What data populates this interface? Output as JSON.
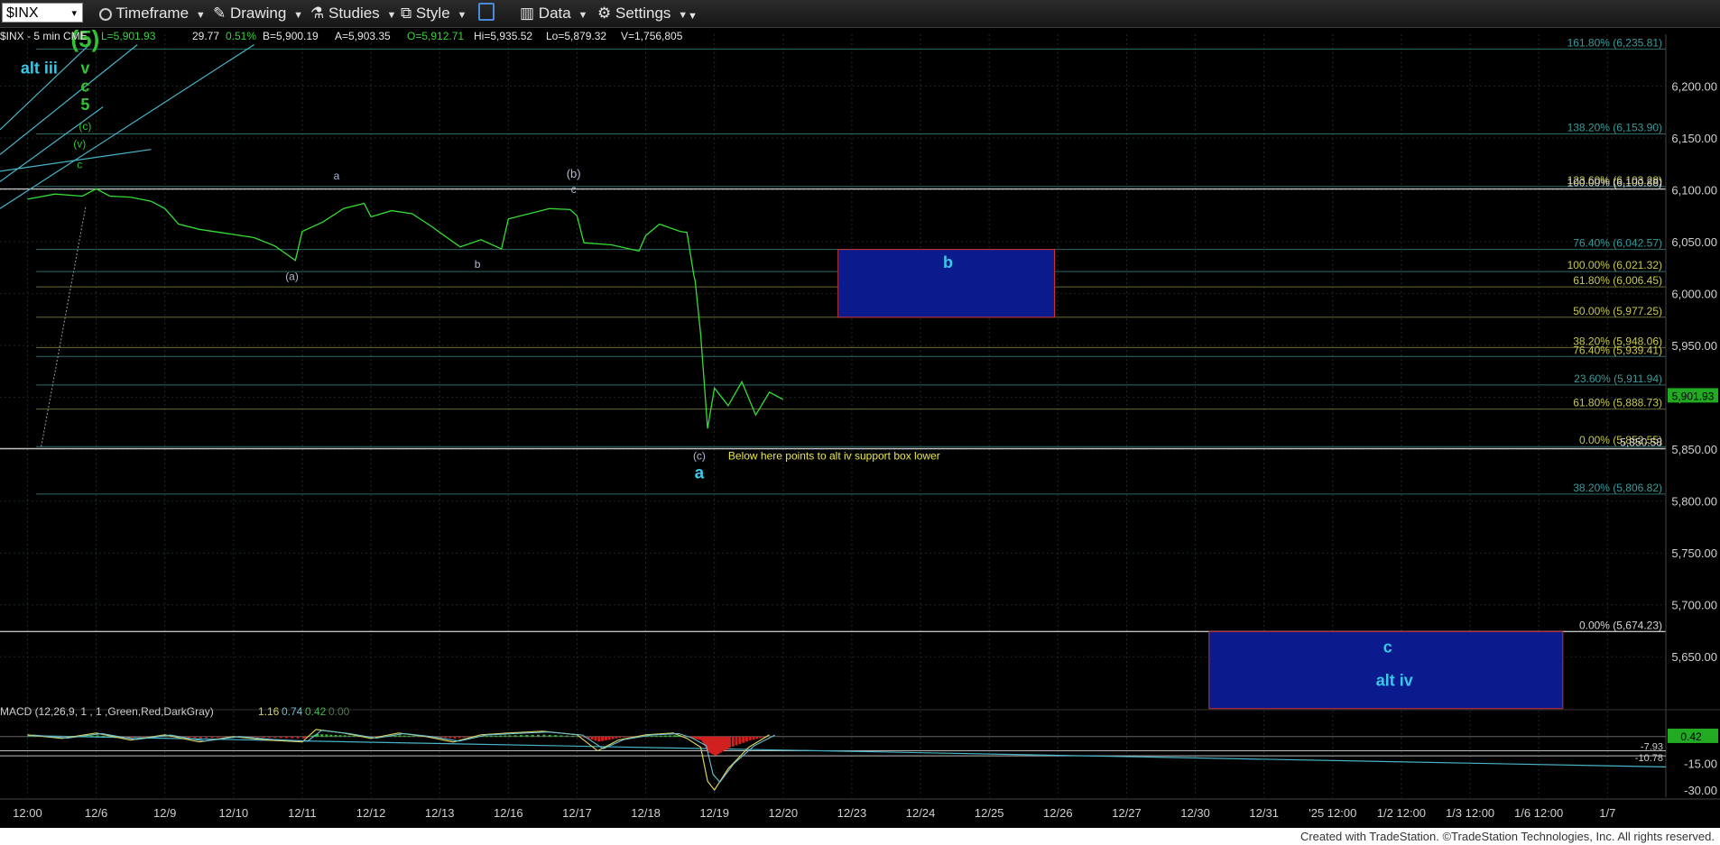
{
  "toolbar": {
    "symbol": "$INX",
    "timeframe": "Timeframe",
    "drawing": "Drawing",
    "studies": "Studies",
    "style": "Style",
    "data": "Data",
    "settings": "Settings"
  },
  "header": {
    "symbol_line": "$INX - 5 min  CME",
    "last": "L=5,901.93",
    "change": "29.77",
    "pct": "0.51%",
    "bid": "B=5,900.19",
    "ask": "A=5,903.35",
    "open": "O=5,912.71",
    "high": "Hi=5,935.52",
    "low": "Lo=5,879.32",
    "volume": "V=1,756,805"
  },
  "colors": {
    "price": "#33dd33",
    "fib_label": "#c8c850",
    "fib_teal": "#3a9a9a",
    "wave_label": "#b0b8d8",
    "box_blue": "#0b1a8c",
    "box_border": "#d03030",
    "alt_label": "#39c8e8",
    "wave5_green": "#31c431"
  },
  "chart_data": [
    {
      "type": "line",
      "title": "$INX - 5 min",
      "y_axis": {
        "ticks": [
          "6,200.00",
          "6,150.00",
          "6,100.00",
          "6,050.00",
          "6,000.00",
          "5,950.00",
          "5,900.00",
          "5,850.00",
          "5,800.00",
          "5,750.00",
          "5,700.00",
          "5,650.00"
        ],
        "tick_values": [
          6200,
          6150,
          6100,
          6050,
          6000,
          5950,
          5900,
          5850,
          5800,
          5750,
          5700,
          5650
        ],
        "range": [
          5605,
          6250
        ]
      },
      "x_axis": {
        "ticks": [
          "12:00",
          "12/6",
          "12/9",
          "12/10",
          "12/11",
          "12/12",
          "12/13",
          "12/16",
          "12/17",
          "12/18",
          "12/19",
          "12/20",
          "12/23",
          "12/24",
          "12/25",
          "12/26",
          "12/27",
          "12/30",
          "12/31",
          "'25 12:00",
          "1/2 12:00",
          "1/3 12:00",
          "1/6 12:00",
          "1/7"
        ],
        "tick_index": [
          0,
          1,
          2,
          3,
          4,
          5,
          6,
          7,
          8,
          9,
          10,
          11,
          12,
          13,
          14,
          15,
          16,
          17,
          18,
          19,
          20,
          21,
          22,
          23
        ],
        "range": [
          -0.4,
          23.85
        ]
      },
      "series": [
        {
          "x": [
            0,
            0.4,
            0.8,
            1.0,
            1.2,
            1.5,
            1.8,
            2.0,
            2.2,
            2.5,
            2.8,
            3.0,
            3.3,
            3.6,
            3.9,
            4.0,
            4.3,
            4.6,
            4.9,
            5.0,
            5.3,
            5.6,
            5.9,
            6.0,
            6.3,
            6.6,
            6.9,
            7.0,
            7.3,
            7.6,
            7.9,
            8.0,
            8.1,
            8.5,
            8.9,
            9.0,
            9.2,
            9.5,
            9.6,
            9.7,
            9.72,
            9.8,
            9.9,
            10.0,
            10.2,
            10.4,
            10.6,
            10.8,
            11.0
          ],
          "y": [
            6091,
            6096,
            6094,
            6101,
            6094,
            6093,
            6089,
            6082,
            6067,
            6062,
            6059,
            6057,
            6054,
            6046,
            6032,
            6060,
            6069,
            6082,
            6087,
            6074,
            6080,
            6077,
            6064,
            6059,
            6045,
            6052,
            6043,
            6072,
            6077,
            6082,
            6081,
            6075,
            6049,
            6047,
            6041,
            6056,
            6067,
            6060,
            6059,
            6018,
            6012,
            5960,
            5870,
            5909,
            5892,
            5915,
            5883,
            5905,
            5898
          ]
        }
      ],
      "fib_levels": [
        {
          "label": "161.80% (6,235.81)",
          "value": 6235.81
        },
        {
          "label": "138.20% (6,153.90)",
          "value": 6153.9
        },
        {
          "label": "123.60% (6,103.28)",
          "value": 6103.28
        },
        {
          "label": "100.00% (6,100.88)",
          "value": 6100.88
        },
        {
          "label": "76.40% (6,042.57)",
          "value": 6042.57
        },
        {
          "label": "100.00% (6,021.32)",
          "value": 6021.32
        },
        {
          "label": "61.80% (6,006.45)",
          "value": 6006.45
        },
        {
          "label": "50.00% (5,977.25)",
          "value": 5977.25
        },
        {
          "label": "38.20% (5,948.06)",
          "value": 5948.06
        },
        {
          "label": "76.40% (5,939.41)",
          "value": 5939.41
        },
        {
          "label": "23.60% (5,911.94)",
          "value": 5911.94
        },
        {
          "label": "61.80% (5,888.73)",
          "value": 5888.73
        },
        {
          "label": "0.00% (5,852.55)",
          "value": 5852.55
        },
        {
          "label": "5,850.58",
          "value": 5850.58
        },
        {
          "label": "38.20% (5,806.82)",
          "value": 5806.82
        },
        {
          "label": "0.00% (5,674.23)",
          "value": 5674.23
        }
      ],
      "last_price": "5,901.93",
      "annotations": {
        "alt_iii": "alt iii",
        "w5": "(5)",
        "wv": "v",
        "wc": "c",
        "w5b": "5",
        "wc_paren": "(c)",
        "wv_paren": "(v)",
        "wc_small": "c",
        "wa_top": "a",
        "wb_paren": "(b)",
        "wc_b": "c",
        "wa_paren": "(a)",
        "wb_small": "b",
        "wc_low": "(c)",
        "wa_big": "a",
        "below_note": "Below here points to alt iv support box lower",
        "box_b": "b",
        "box_c": "c",
        "alt_iv": "alt iv"
      }
    },
    {
      "type": "line",
      "title": "MACD (12,26,9, 1 , 1 ,Green,Red,DarkGray)",
      "values_line": [
        "1.16",
        "0.74",
        "0.42",
        "0.00"
      ],
      "y_axis": {
        "ticks": [
          "-15.00",
          "-30.00"
        ],
        "tick_values": [
          -15,
          -30
        ],
        "range": [
          -34,
          10
        ]
      },
      "levels": [
        {
          "label": "-7.93",
          "value": -7.93
        },
        {
          "label": "-10.78",
          "value": -10.78
        }
      ],
      "last_value": "0.42",
      "series": [
        {
          "name": "MACD",
          "x": [
            0,
            0.5,
            1.0,
            1.5,
            2.0,
            2.5,
            3.0,
            3.5,
            4.0,
            4.2,
            4.6,
            5.0,
            5.4,
            5.8,
            6.2,
            6.6,
            7.0,
            7.5,
            8.0,
            8.3,
            8.6,
            9.0,
            9.4,
            9.6,
            9.8,
            9.9,
            10.0,
            10.2,
            10.5,
            10.8
          ],
          "y": [
            1,
            -1,
            2,
            -2,
            1,
            -3,
            0,
            -2,
            -3,
            4,
            2,
            -1,
            2,
            0,
            -3,
            1,
            2,
            3,
            1,
            -8,
            -2,
            1,
            2,
            -1,
            -6,
            -25,
            -30,
            -18,
            -6,
            1
          ]
        }
      ],
      "trendline": {
        "x": [
          0,
          23.85
        ],
        "y": [
          0.5,
          -17
        ]
      }
    }
  ],
  "footer": "Created with TradeStation. ©TradeStation Technologies, Inc. All rights reserved."
}
